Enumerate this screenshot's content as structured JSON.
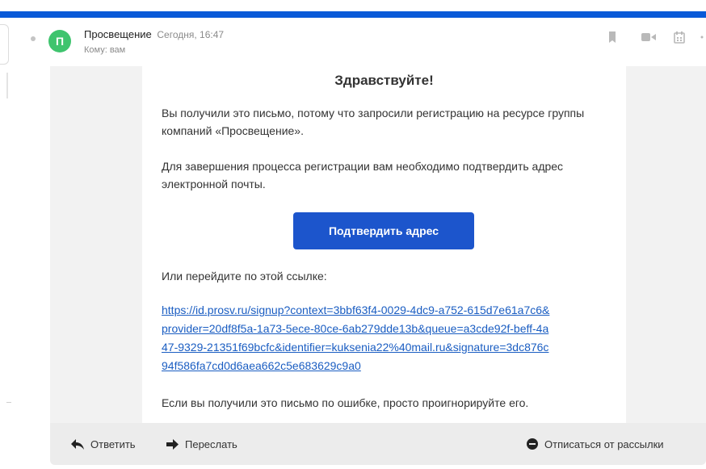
{
  "email": {
    "sender": {
      "initial": "П",
      "name": "Просвещение",
      "date": "Сегодня, 16:47",
      "recipient": "Кому: вам"
    },
    "header_icons": [
      "bookmark-icon",
      "video-icon",
      "calendar-icon",
      "more-icon"
    ],
    "body": {
      "greeting": "Здравствуйте!",
      "paragraph1": "Вы получили это письмо, потому что запросили регистрацию на ресурсе группы компаний «Просвещение».",
      "paragraph2": "Для завершения процесса регистрации вам необходимо подтвердить адрес электронной почты.",
      "confirm_button": "Подтвердить адрес",
      "paragraph3": "Или перейдите по этой ссылке:",
      "link_lines": [
        "https://id.prosv.ru/signup?context=3bbf63f4-0029-4dc9-a752-615d7e61a7c6&",
        "provider=20df8f5a-1a73-5ece-80ce-6ab279dde13b&queue=a3cde92f-beff-4a",
        "47-9329-21351f69bcfc&identifier=kuksenia22%40mail.ru&signature=3dc876c",
        "94f586fa7cd0d6aea662c5e683629c9a0"
      ],
      "paragraph4": "Если вы получили это письмо по ошибке, просто проигнорируйте его."
    },
    "footer": {
      "reply": "Ответить",
      "forward": "Переслать",
      "unsubscribe": "Отписаться от рассылки"
    }
  },
  "colors": {
    "accent_stripe": "#0a5ad8",
    "button": "#1c55cc",
    "link": "#1a5dc2",
    "avatar": "#3fc46e"
  }
}
